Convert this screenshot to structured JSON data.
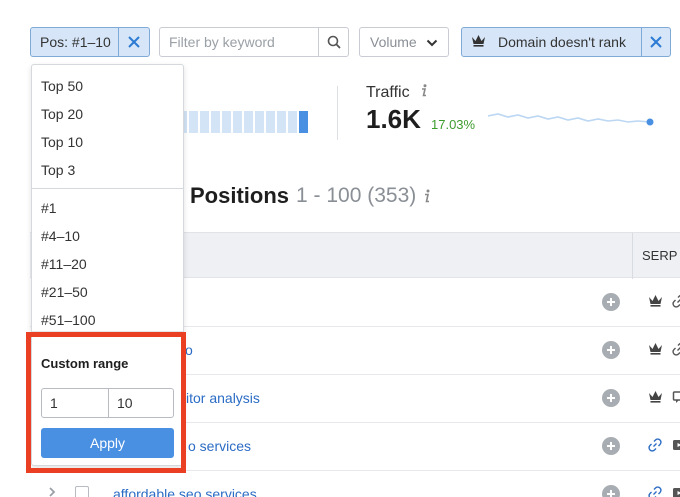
{
  "filters": {
    "position_label": "Pos: #1–10",
    "search_placeholder": "Filter by keyword",
    "volume_label": "Volume",
    "domain_label": "Domain doesn't rank"
  },
  "overview": {
    "traffic_title": "Traffic",
    "traffic_value": "1.6K",
    "traffic_change": "17.03%"
  },
  "positions": {
    "title": "Positions",
    "range": "1 - 100 (353)"
  },
  "table": {
    "serp_header": "SERP F",
    "rows": [
      {
        "keyword": ""
      },
      {
        "keyword": "o"
      },
      {
        "keyword": "itor analysis"
      },
      {
        "keyword": "o services"
      },
      {
        "keyword": "affordable seo services"
      }
    ]
  },
  "dropdown": {
    "group1": [
      "Top 50",
      "Top 20",
      "Top 10",
      "Top 3"
    ],
    "group2": [
      "#1",
      "#4–10",
      "#11–20",
      "#21–50",
      "#51–100"
    ],
    "custom_range_title": "Custom range",
    "from_value": "1",
    "to_value": "10",
    "apply_label": "Apply"
  },
  "colors": {
    "accent": "#4a90e2",
    "highlight_border": "#ea3f23",
    "positive_change": "#3d9c2e",
    "link": "#2b6cc4"
  }
}
